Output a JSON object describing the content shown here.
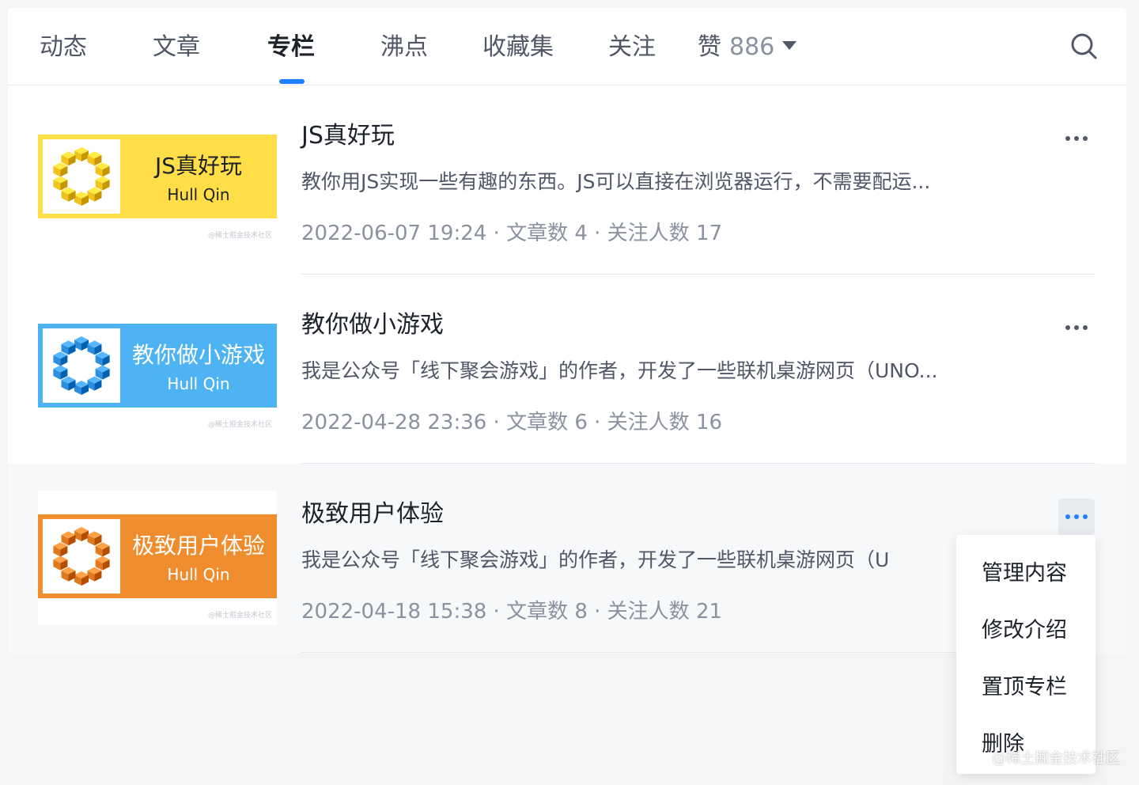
{
  "tabs": [
    {
      "label": "动态"
    },
    {
      "label": "文章"
    },
    {
      "label": "专栏"
    },
    {
      "label": "沸点"
    },
    {
      "label": "收藏集"
    },
    {
      "label": "关注"
    },
    {
      "label": "赞",
      "count": "886"
    }
  ],
  "active_tab": "专栏",
  "columns": [
    {
      "title": "JS真好玩",
      "desc": "教你用JS实现一些有趣的东西。JS可以直接在浏览器运行，不需要配运...",
      "meta": "2022-06-07 19:24 · 文章数 4 · 关注人数 17",
      "cover_title": "JS真好玩",
      "cover_author": "Hull Qin",
      "cover_watermark": "@稀土掘金技术社区",
      "cover_color": "#ffde48",
      "cube_color": "#f2c31c",
      "cover_text_color": "#1d2129"
    },
    {
      "title": "教你做小游戏",
      "desc": "我是公众号「线下聚会游戏」的作者，开发了一些联机桌游网页（UNO...",
      "meta": "2022-04-28 23:36 · 文章数 6 · 关注人数 16",
      "cover_title": "教你做小游戏",
      "cover_author": "Hull Qin",
      "cover_watermark": "@稀土掘金技术社区",
      "cover_color": "#4db3f2",
      "cube_color": "#2e8ede",
      "cover_text_color": "#ffffff"
    },
    {
      "title": "极致用户体验",
      "desc": "我是公众号「线下聚会游戏」的作者，开发了一些联机桌游网页（U",
      "meta": "2022-04-18 15:38 · 文章数 8 · 关注人数 21",
      "cover_title": "极致用户体验",
      "cover_author": "Hull Qin",
      "cover_watermark": "@稀土掘金技术社区",
      "cover_color": "#ef8d2e",
      "cube_color": "#e07a1f",
      "cover_text_color": "#ffffff"
    }
  ],
  "menu": {
    "items": [
      "管理内容",
      "修改介绍",
      "置顶专栏",
      "删除"
    ]
  },
  "watermark": "@稀土掘金技术社区",
  "colors": {
    "accent": "#1e80ff",
    "text_primary": "#1d2129",
    "text_secondary": "#515767",
    "text_muted": "#8a919f"
  }
}
